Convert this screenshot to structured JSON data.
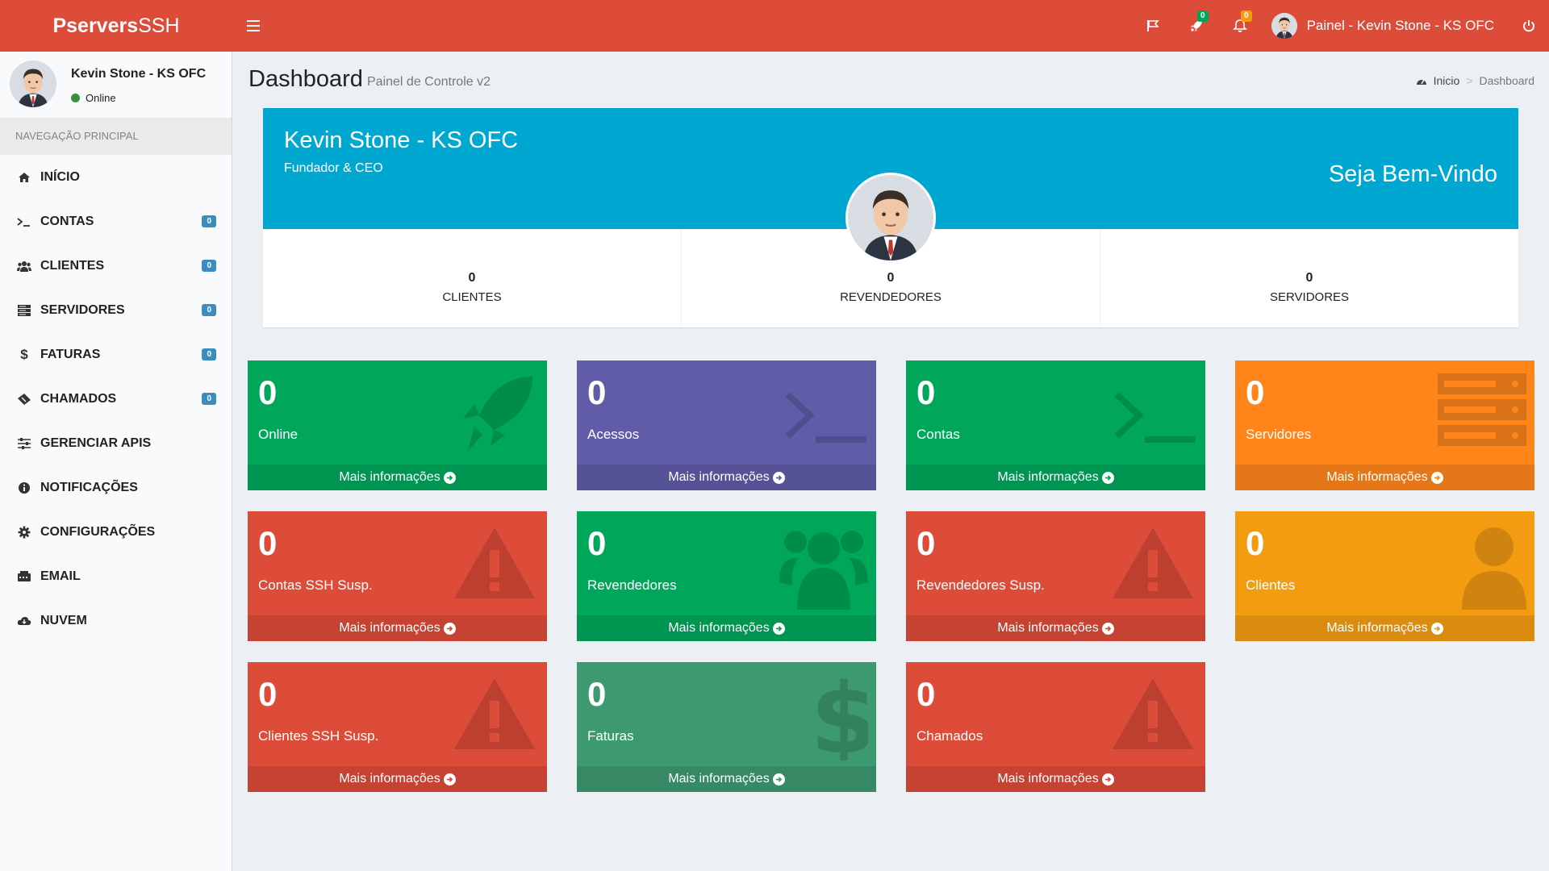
{
  "brand": {
    "bold": "Pservers",
    "light": "SSH"
  },
  "colors": {
    "header": "#dd4b39",
    "widget_head": "#00a7d0",
    "green": "#00a65a",
    "purple": "#605ca8",
    "orange": "#ff851b",
    "red": "#dd4b39",
    "yellow": "#f39c12",
    "olive": "#3d9970",
    "badge_blue": "#3c8dbc"
  },
  "header": {
    "notif_tasks": "0",
    "notif_bell": "0",
    "user_label": "Painel - Kevin Stone - KS OFC",
    "icons": [
      "flag-icon",
      "rocket-icon",
      "bell-icon",
      "power-icon"
    ]
  },
  "sidebar": {
    "user_name": "Kevin Stone - KS OFC",
    "status": "Online",
    "nav_header": "NAVEGAÇÃO PRINCIPAL",
    "items": [
      {
        "label": "INÍCIO",
        "badge": null,
        "icon": "home-icon"
      },
      {
        "label": "CONTAS",
        "badge": "0",
        "icon": "terminal-icon"
      },
      {
        "label": "CLIENTES",
        "badge": "0",
        "icon": "users-icon"
      },
      {
        "label": "SERVIDORES",
        "badge": "0",
        "icon": "server-icon"
      },
      {
        "label": "FATURAS",
        "badge": "0",
        "icon": "dollar-icon"
      },
      {
        "label": "CHAMADOS",
        "badge": "0",
        "icon": "ticket-icon"
      },
      {
        "label": "GERENCIAR APIS",
        "badge": null,
        "icon": "sliders-icon"
      },
      {
        "label": "NOTIFICAÇÕES",
        "badge": null,
        "icon": "info-icon"
      },
      {
        "label": "CONFIGURAÇÕES",
        "badge": null,
        "icon": "gear-icon"
      },
      {
        "label": "EMAIL",
        "badge": null,
        "icon": "fax-icon"
      },
      {
        "label": "NUVEM",
        "badge": null,
        "icon": "cloud-icon"
      }
    ]
  },
  "page": {
    "title": "Dashboard",
    "subtitle": "Painel de Controle v2",
    "breadcrumb_home": "Inicio",
    "breadcrumb_current": "Dashboard"
  },
  "widget": {
    "name": "Kevin Stone - KS OFC",
    "role": "Fundador & CEO",
    "welcome": "Seja Bem-Vindo",
    "stats": [
      {
        "value": "0",
        "label": "CLIENTES"
      },
      {
        "value": "0",
        "label": "REVENDEDORES"
      },
      {
        "value": "0",
        "label": "SERVIDORES"
      }
    ]
  },
  "footer_label": "Mais informações",
  "boxes": [
    {
      "value": "0",
      "label": "Online",
      "color": "#00a65a",
      "icon": "rocket-icon"
    },
    {
      "value": "0",
      "label": "Acessos",
      "color": "#605ca8",
      "icon": "terminal-icon"
    },
    {
      "value": "0",
      "label": "Contas",
      "color": "#00a65a",
      "icon": "terminal-icon"
    },
    {
      "value": "0",
      "label": "Servidores",
      "color": "#ff851b",
      "icon": "server-icon"
    },
    {
      "value": "0",
      "label": "Contas SSH Susp.",
      "color": "#dd4b39",
      "icon": "warning-icon"
    },
    {
      "value": "0",
      "label": "Revendedores",
      "color": "#00a65a",
      "icon": "users-icon"
    },
    {
      "value": "0",
      "label": "Revendedores Susp.",
      "color": "#dd4b39",
      "icon": "warning-icon"
    },
    {
      "value": "0",
      "label": "Clientes",
      "color": "#f39c12",
      "icon": "user-icon"
    },
    {
      "value": "0",
      "label": "Clientes SSH Susp.",
      "color": "#dd4b39",
      "icon": "warning-icon"
    },
    {
      "value": "0",
      "label": "Faturas",
      "color": "#3d9970",
      "icon": "dollar-icon"
    },
    {
      "value": "0",
      "label": "Chamados",
      "color": "#dd4b39",
      "icon": "warning-icon"
    }
  ]
}
